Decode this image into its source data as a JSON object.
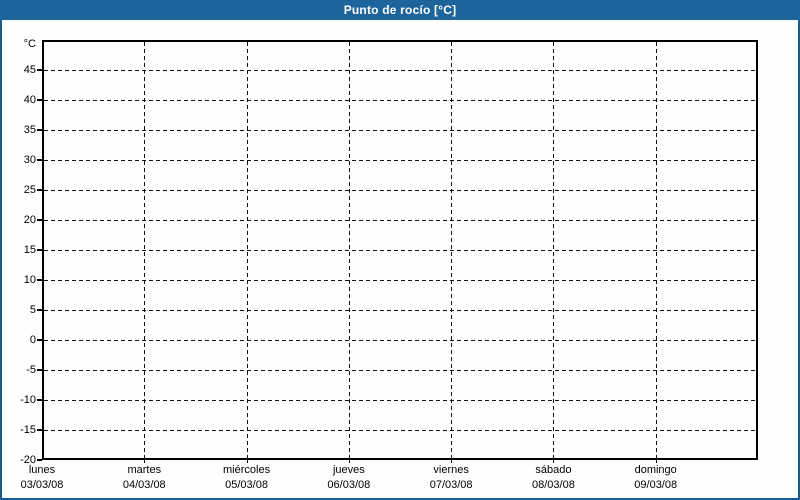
{
  "window": {
    "title": "Punto de rocío [°C]"
  },
  "colors": {
    "titlebar_bg": "#1e649c",
    "titlebar_text": "#ffffff",
    "outer_border": "#1b5c8e",
    "page_bg": "#fcfffc",
    "axis_line": "#000000",
    "grid_line": "#111111",
    "label_text": "#000000"
  },
  "chart_data": {
    "type": "line",
    "title": "Punto de rocío [°C]",
    "xlabel": "",
    "ylabel": "°C",
    "ylim": [
      -20,
      50
    ],
    "y_ticks": [
      45,
      40,
      35,
      30,
      25,
      20,
      15,
      10,
      5,
      0,
      -5,
      -10,
      -15,
      -20
    ],
    "categories": [
      "lunes",
      "martes",
      "miércoles",
      "jueves",
      "viernes",
      "sábado",
      "domingo"
    ],
    "category_dates": [
      "03/03/08",
      "04/03/08",
      "05/03/08",
      "06/03/08",
      "07/03/08",
      "08/03/08",
      "09/03/08"
    ],
    "series": [],
    "grid": "dashed horizontal every 5°C, dashed vertical per day",
    "legend": "none",
    "note": "empty plot – no data series drawn"
  }
}
